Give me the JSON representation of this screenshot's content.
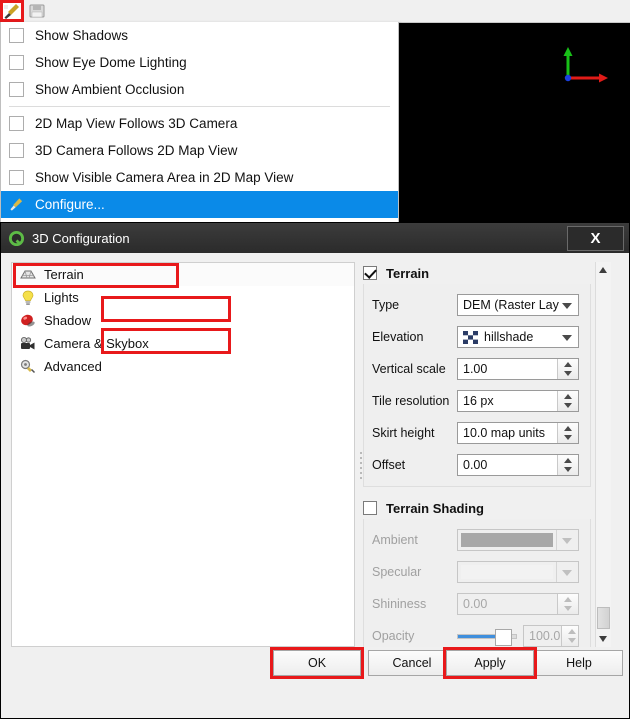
{
  "toolbar": {
    "buttons": [
      {
        "name": "configure-3d-tool",
        "icon": "wrench-icon",
        "highlighted": true
      },
      {
        "name": "save-view-tool",
        "icon": "save-icon",
        "highlighted": false
      }
    ]
  },
  "view3d": {
    "background_color": "#000000",
    "gizmo": {
      "x_axis_color": "#e01b18",
      "y_axis_color": "#18c018",
      "origin_color": "#1a40e0"
    }
  },
  "menu": {
    "items": [
      {
        "label": "Show Shadows",
        "checked": false,
        "type": "checkbox"
      },
      {
        "label": "Show Eye Dome Lighting",
        "checked": false,
        "type": "checkbox"
      },
      {
        "label": "Show Ambient Occlusion",
        "checked": false,
        "type": "checkbox"
      },
      {
        "separator": true
      },
      {
        "label": "2D Map View Follows 3D Camera",
        "checked": false,
        "type": "checkbox"
      },
      {
        "label": "3D Camera Follows 2D Map View",
        "checked": false,
        "type": "checkbox"
      },
      {
        "label": "Show Visible Camera Area in 2D Map View",
        "checked": false,
        "type": "checkbox"
      },
      {
        "label": "Configure...",
        "selected": true,
        "type": "action",
        "icon": "wrench-icon"
      }
    ],
    "highlight_color": "#0a8ae8"
  },
  "dialog": {
    "title": "3D Configuration",
    "logo": "qgis-logo-icon",
    "close_label": "X",
    "sidebar": [
      {
        "label": "Terrain",
        "icon": "terrain-icon",
        "active": true,
        "highlighted": true
      },
      {
        "label": "Lights",
        "icon": "lightbulb-icon",
        "active": false
      },
      {
        "label": "Shadow",
        "icon": "shadow-icon",
        "active": false
      },
      {
        "label": "Camera & Skybox",
        "icon": "camera-icon",
        "active": false
      },
      {
        "label": "Advanced",
        "icon": "gears-icon",
        "active": false
      }
    ],
    "terrain": {
      "group_label": "Terrain",
      "group_checked": true,
      "fields": [
        {
          "label": "Type",
          "value": "DEM (Raster Lay",
          "control": "combo",
          "highlighted": true
        },
        {
          "label": "Elevation",
          "value": "hillshade",
          "control": "combo",
          "icon": "raster-layer-icon",
          "highlighted": true
        },
        {
          "label": "Vertical scale",
          "value": "1.00",
          "control": "spin"
        },
        {
          "label": "Tile resolution",
          "value": "16 px",
          "control": "spin"
        },
        {
          "label": "Skirt height",
          "value": "10.0 map units",
          "control": "spin"
        },
        {
          "label": "Offset",
          "value": "0.00",
          "control": "spin"
        }
      ]
    },
    "terrain_shading": {
      "group_label": "Terrain Shading",
      "group_checked": false,
      "fields": [
        {
          "label": "Ambient",
          "control": "color",
          "color": "#a8a8a8",
          "disabled": true
        },
        {
          "label": "Specular",
          "control": "color",
          "color": "#f2f2f2",
          "disabled": true
        },
        {
          "label": "Shininess",
          "value": "0.00",
          "control": "spin",
          "disabled": true
        },
        {
          "label": "Opacity",
          "value": "100.0 %",
          "control": "slider-spin",
          "disabled": true,
          "slider_percent": 100
        }
      ]
    },
    "buttons": [
      {
        "label": "OK",
        "highlighted": true
      },
      {
        "label": "Cancel",
        "highlighted": false
      },
      {
        "label": "Apply",
        "highlighted": true
      },
      {
        "label": "Help",
        "highlighted": false
      }
    ]
  },
  "annotation": {
    "highlight_color": "#e8191b"
  }
}
